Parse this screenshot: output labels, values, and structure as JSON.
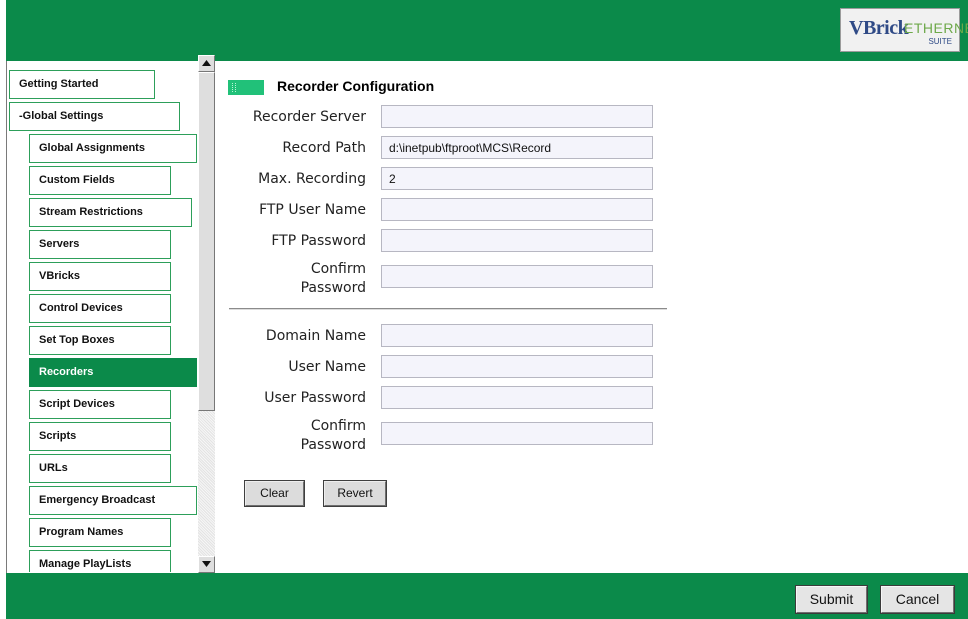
{
  "brand": {
    "logo_main": "VBrick",
    "logo_sub": "ETHERNETV",
    "logo_suite": "SUITE"
  },
  "nav": {
    "items": [
      {
        "label": "Getting Started"
      },
      {
        "label": "-Global Settings"
      },
      {
        "label": "Global Assignments"
      },
      {
        "label": "Custom Fields"
      },
      {
        "label": "Stream Restrictions"
      },
      {
        "label": "Servers"
      },
      {
        "label": "VBricks"
      },
      {
        "label": "Control Devices"
      },
      {
        "label": "Set Top Boxes"
      },
      {
        "label": "Recorders",
        "active": true
      },
      {
        "label": "Script Devices"
      },
      {
        "label": "Scripts"
      },
      {
        "label": "URLs"
      },
      {
        "label": "Emergency Broadcast"
      },
      {
        "label": "Program Names"
      },
      {
        "label": "Manage PlayLists"
      }
    ]
  },
  "main": {
    "title": "Recorder Configuration",
    "fields": {
      "recorder_server": {
        "label": "Recorder Server",
        "value": ""
      },
      "record_path": {
        "label": "Record Path",
        "value": "d:\\inetpub\\ftproot\\MCS\\Record"
      },
      "max_recording": {
        "label": "Max. Recording",
        "value": "2"
      },
      "ftp_user": {
        "label": "FTP User Name",
        "value": ""
      },
      "ftp_password": {
        "label": "FTP Password",
        "value": ""
      },
      "ftp_confirm": {
        "label_line1": "Confirm",
        "label_line2": "Password",
        "value": ""
      },
      "domain_name": {
        "label": "Domain Name",
        "value": ""
      },
      "user_name": {
        "label": "User Name",
        "value": ""
      },
      "user_password": {
        "label": "User Password",
        "value": ""
      },
      "user_confirm": {
        "label_line1": "Confirm",
        "label_line2": "Password",
        "value": ""
      }
    },
    "buttons": {
      "clear": "Clear",
      "revert": "Revert"
    }
  },
  "footer": {
    "submit": "Submit",
    "cancel": "Cancel"
  },
  "colors": {
    "brand_green": "#0b8a4a",
    "accent_green": "#21c179",
    "field_bg": "#f4f4fb"
  }
}
